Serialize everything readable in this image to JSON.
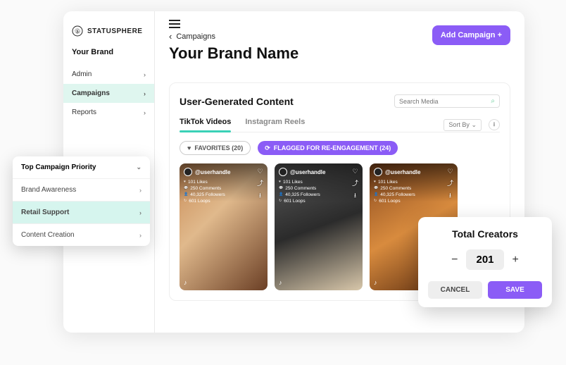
{
  "logo": {
    "text": "STATUSPHERE"
  },
  "sidebar": {
    "brand_label": "Your Brand",
    "items": [
      {
        "label": "Admin"
      },
      {
        "label": "Campaigns"
      },
      {
        "label": "Reports"
      }
    ]
  },
  "header": {
    "crumb": "Campaigns",
    "title": "Your Brand Name",
    "add_button": "Add Campaign  +"
  },
  "panel": {
    "title": "User-Generated Content",
    "search_placeholder": "Search Media",
    "tabs": [
      {
        "label": "TikTok Videos"
      },
      {
        "label": "Instagram Reels"
      }
    ],
    "sort_label": "Sort By",
    "chips": {
      "favorites": "FAVORITES (20)",
      "flagged": "FLAGGED FOR RE-ENGAGEMENT (24)"
    },
    "cards": [
      {
        "handle": "@userhandle",
        "stats": [
          "101 Likes",
          "250 Comments",
          "40,325 Followers",
          "601 Loops"
        ],
        "bg": "linear-gradient(135deg,#c98b56,#e0b98c 40%,#6b3f25)"
      },
      {
        "handle": "@userhandle",
        "stats": [
          "101 Likes",
          "250 Comments",
          "40,325 Followers",
          "601 Loops"
        ],
        "bg": "linear-gradient(160deg,#5b5b5b,#2b2b2b 50%,#d8c7aa)"
      },
      {
        "handle": "@userhandle",
        "stats": [
          "101 Likes",
          "250 Comments",
          "40,325 Followers",
          "601 Loops"
        ],
        "bg": "linear-gradient(150deg,#8a4a1f,#d88b3e 50%,#5a2c0f)"
      }
    ]
  },
  "dropdown": {
    "head": "Top Campaign Priority",
    "items": [
      {
        "label": "Brand Awareness"
      },
      {
        "label": "Retail Support"
      },
      {
        "label": "Content Creation"
      }
    ]
  },
  "modal": {
    "title": "Total Creators",
    "value": "201",
    "cancel": "CANCEL",
    "save": "SAVE"
  }
}
